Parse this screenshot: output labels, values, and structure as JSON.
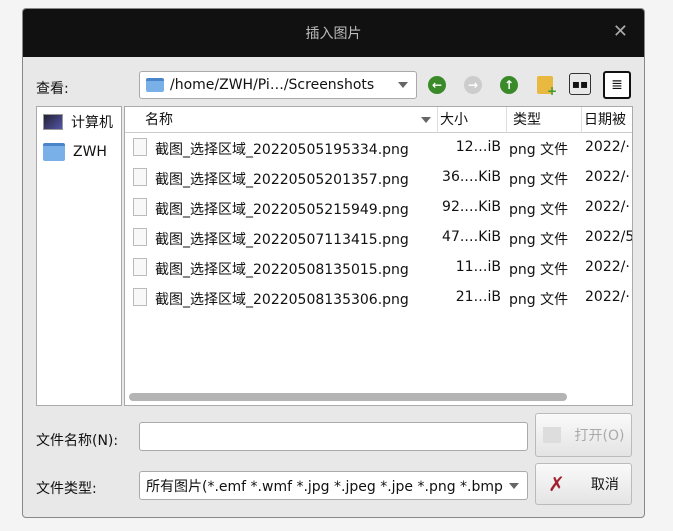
{
  "title": "插入图片",
  "look_in_label": "查看:",
  "path": "/home/ZWH/Pi…/Screenshots",
  "sidebar": [
    {
      "label": "计算机",
      "icon": "computer-icon"
    },
    {
      "label": "ZWH",
      "icon": "folder-icon"
    }
  ],
  "columns": [
    "名称",
    "大小",
    "类型",
    "日期被修改"
  ],
  "columns_visible": [
    "名称",
    "大小",
    "类型",
    "日期被"
  ],
  "files": [
    {
      "name": "截图_选择区域_20220505195334.png",
      "size": "12…iB",
      "type": "png 文件",
      "date": "2022/·"
    },
    {
      "name": "截图_选择区域_20220505201357.png",
      "size": "36.…KiB",
      "type": "png 文件",
      "date": "2022/·"
    },
    {
      "name": "截图_选择区域_20220505215949.png",
      "size": "92.…KiB",
      "type": "png 文件",
      "date": "2022/·"
    },
    {
      "name": "截图_选择区域_20220507113415.png",
      "size": "47.…KiB",
      "type": "png 文件",
      "date": "2022/5"
    },
    {
      "name": "截图_选择区域_20220508135015.png",
      "size": "11…iB",
      "type": "png 文件",
      "date": "2022/·"
    },
    {
      "name": "截图_选择区域_20220508135306.png",
      "size": "21…iB",
      "type": "png 文件",
      "date": "2022/·"
    }
  ],
  "filename_label": "文件名称(N):",
  "filename_value": "",
  "filetype_label": "文件类型:",
  "filetype_value": "所有图片(*.emf *.wmf *.jpg *.jpeg *.jpe *.png *.bmp",
  "open_label": "打开(O)",
  "cancel_label": "取消"
}
